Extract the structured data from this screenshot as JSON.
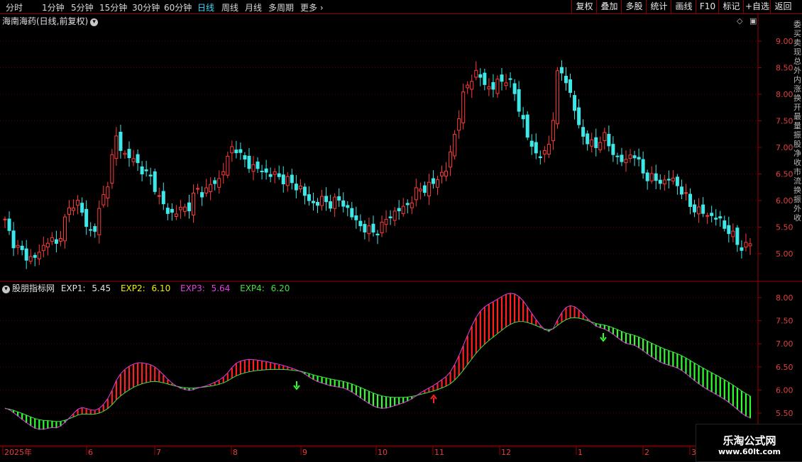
{
  "toolbar": {
    "timeframes": [
      "分时",
      "1分钟",
      "5分钟",
      "15分钟",
      "30分钟",
      "60分钟",
      "日线",
      "周线",
      "月线",
      "多周期"
    ],
    "active": "日线",
    "more": "更多",
    "buttons": [
      "复权",
      "叠加",
      "多股",
      "统计",
      "画线",
      "F10",
      "标记",
      "+自选",
      "返回"
    ]
  },
  "main": {
    "title": "海南海药(日线,前复权)",
    "y_ticks": [
      "9.00",
      "8.50",
      "8.00",
      "7.50",
      "7.00",
      "6.50",
      "6.00",
      "5.50",
      "5.00"
    ]
  },
  "indicator": {
    "name": "股朋指标网",
    "exp": [
      {
        "label": "EXP1:",
        "value": "5.45",
        "color": "#e0e0e0"
      },
      {
        "label": "EXP2:",
        "value": "6.10",
        "color": "#f0f000"
      },
      {
        "label": "EXP3:",
        "value": "5.64",
        "color": "#e040e0"
      },
      {
        "label": "EXP4:",
        "value": "6.20",
        "color": "#40e040"
      }
    ],
    "y_ticks": [
      "8.00",
      "7.50",
      "7.00",
      "6.50",
      "6.00",
      "5.50"
    ]
  },
  "xaxis": {
    "labels": [
      "2025年",
      "6",
      "7",
      "8",
      "9",
      "10",
      "11",
      "12",
      "1",
      "2",
      "3"
    ]
  },
  "watermark": {
    "line1": "乐淘公式网",
    "line2": "www.60lt.com"
  },
  "colors": {
    "up": "#ff3b3b",
    "down": "#3ee8e8",
    "grid": "#5a0000",
    "axis": "#9b0000"
  },
  "chart_data": {
    "type": "candlestick",
    "series_close_approx": [
      5.6,
      5.25,
      5.05,
      4.95,
      4.9,
      5.1,
      5.3,
      5.15,
      5.6,
      5.9,
      6.0,
      5.5,
      5.4,
      5.9,
      6.4,
      7.2,
      6.9,
      6.8,
      6.7,
      6.5,
      6.4,
      6.0,
      5.8,
      5.75,
      5.85,
      5.9,
      6.2,
      6.15,
      6.3,
      6.4,
      6.7,
      7.1,
      6.8,
      6.7,
      6.6,
      6.55,
      6.5,
      6.45,
      6.4,
      6.3,
      6.25,
      6.0,
      5.95,
      6.0,
      5.95,
      6.0,
      5.95,
      5.7,
      5.55,
      5.45,
      5.4,
      5.5,
      5.7,
      5.8,
      5.85,
      6.0,
      6.2,
      6.25,
      6.3,
      6.5,
      6.6,
      7.3,
      7.9,
      8.3,
      8.4,
      8.2,
      8.1,
      8.25,
      8.3,
      8.05,
      7.6,
      7.1,
      6.9,
      6.8,
      7.2,
      8.5,
      8.3,
      7.8,
      7.3,
      7.1,
      7.0,
      7.25,
      7.0,
      6.8,
      6.7,
      6.95,
      6.65,
      6.45,
      6.4,
      6.35,
      6.4,
      6.35,
      6.1,
      5.9,
      5.8,
      5.75,
      5.7,
      5.6,
      5.45,
      5.25,
      5.1,
      5.2
    ]
  }
}
